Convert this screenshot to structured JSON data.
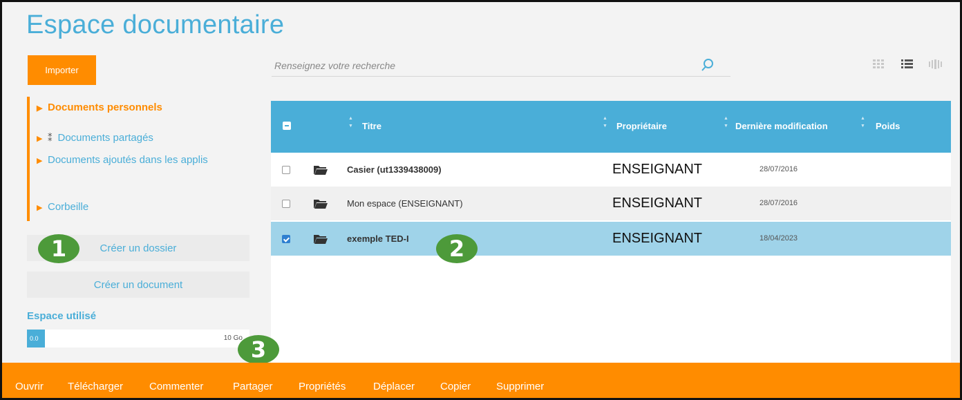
{
  "page": {
    "title": "Espace documentaire"
  },
  "sidebar": {
    "import_label": "Importer",
    "tree": [
      {
        "label": "Documents personnels",
        "active": true
      },
      {
        "label": "Documents partagés",
        "active": false
      },
      {
        "label": "Documents ajoutés dans les applis",
        "active": false
      },
      {
        "label": "Corbeille",
        "active": false
      }
    ],
    "create_folder_label": "Créer un dossier",
    "create_document_label": "Créer un document",
    "space_used_label": "Espace utilisé",
    "space_used_value": "0.0",
    "space_used_fraction": 0.08,
    "space_total": "10 Go"
  },
  "search": {
    "placeholder": "Renseignez votre recherche"
  },
  "view_modes": [
    "grid-view-icon",
    "list-view-icon",
    "carousel-view-icon"
  ],
  "table": {
    "headers": {
      "title": "Titre",
      "owner": "Propriétaire",
      "modified": "Dernière modification",
      "size": "Poids"
    },
    "rows": [
      {
        "title": "Casier (ut1339438009)",
        "owner": "ENSEIGNANT",
        "modified": "28/07/2016",
        "size": "",
        "checked": false
      },
      {
        "title": "Mon espace (ENSEIGNANT)",
        "owner": "ENSEIGNANT",
        "modified": "28/07/2016",
        "size": "",
        "checked": false
      },
      {
        "title": "exemple TED-I",
        "owner": "ENSEIGNANT",
        "modified": "18/04/2023",
        "size": "",
        "checked": true
      }
    ]
  },
  "callouts": [
    "1",
    "2",
    "3"
  ],
  "actions": [
    "Ouvrir",
    "Télécharger",
    "Commenter",
    "Partager",
    "Propriétés",
    "Déplacer",
    "Copier",
    "Supprimer"
  ],
  "colors": {
    "accent": "#ff8c00",
    "primary": "#4aaed8",
    "selected_row": "#9fd3e9",
    "callout": "#4d9a3a"
  }
}
